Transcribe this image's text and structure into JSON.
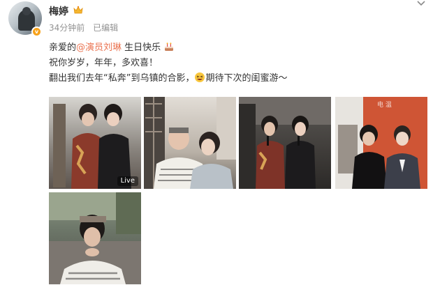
{
  "user": {
    "name": "梅婷",
    "time": "34分钟前",
    "edited": "已编辑",
    "badge_icon": "crown-icon",
    "verified_icon": "verified-v-icon",
    "verified_text": "v",
    "verified_color": "#f7a21b"
  },
  "post": {
    "line1_prefix": "亲爱的",
    "mention": "@演员刘琳",
    "line1_suffix": " 生日快乐",
    "line2": "祝你岁岁，年年，多欢喜！",
    "line3_prefix": "翻出我们去年“私奔”到乌镇的合影，",
    "line3_suffix": "期待下次的闺蜜游～",
    "mention_color": "#eb7350"
  },
  "photos": {
    "count": 5,
    "p1_live": "Live",
    "p4_watermark": "电  温"
  }
}
